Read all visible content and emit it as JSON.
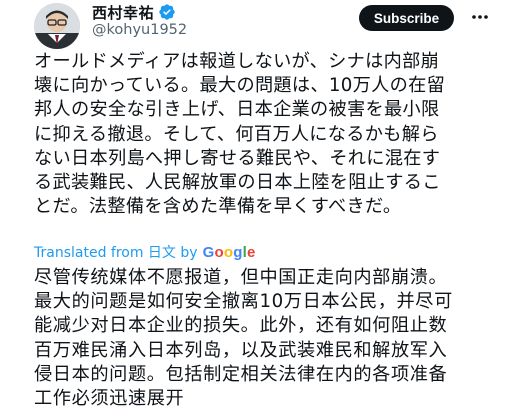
{
  "author": {
    "display_name": "西村幸祐",
    "handle": "@kohyu1952"
  },
  "actions": {
    "subscribe_label": "Subscribe"
  },
  "post": {
    "text": "オールドメディアは報道しないが、シナは内部崩\n壊に向かっている。最大の問題は、10万人の在留\n邦人の安全な引き上げ、日本企業の被害を最小限\nに抑える撤退。そして、何百万人になるかも解ら\nない日本列島へ押し寄せる難民や、それに混在す\nる武装難民、人民解放軍の日本上陸を阻止するこ\nとだ。法整備を含めた準備を早くすべきだ。"
  },
  "translation": {
    "label": "Translated from 日文 by",
    "provider_letters": [
      "G",
      "o",
      "o",
      "g",
      "l",
      "e"
    ],
    "provider_colors": [
      "#4285F4",
      "#EA4335",
      "#FBBC05",
      "#4285F4",
      "#34A853",
      "#EA4335"
    ],
    "text": "尽管传统媒体不愿报道，但中国正走向内部崩溃。\n最大的问题是如何安全撤离10万日本公民，并尽可\n能减少对日本企业的损失。此外，还有如何阻止数\n百万难民涌入日本列岛，以及武装难民和解放军入\n侵日本的问题。包括制定相关法律在内的各项准备\n工作必须迅速展开"
  },
  "colors": {
    "link_blue": "#1d9bf0",
    "verified_blue": "#1d9bf0",
    "text_primary": "#0f1419",
    "text_secondary": "#536471"
  },
  "icons": {
    "verified": "verified-badge-icon",
    "more": "more-horizontal-icon",
    "avatar": "avatar"
  }
}
